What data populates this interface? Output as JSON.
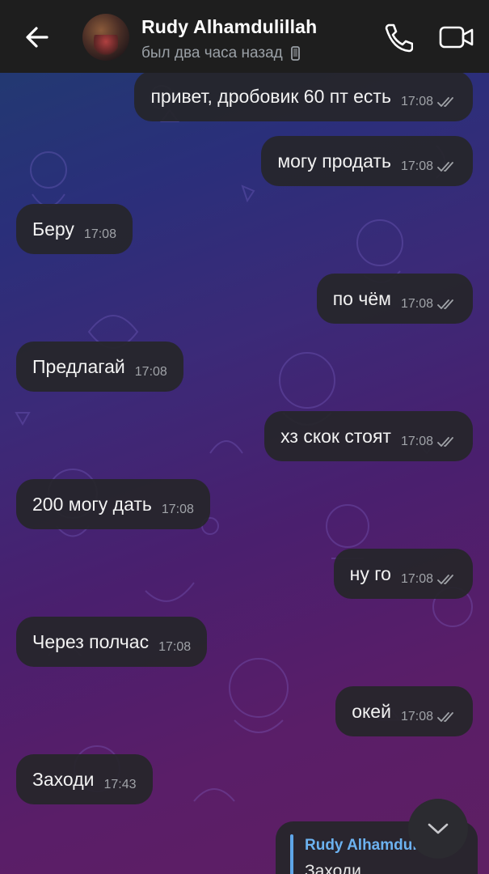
{
  "header": {
    "contact_name": "Rudy Alhamdulillah",
    "status": "был два часа назад",
    "back_icon": "arrow-back-icon",
    "call_icon": "phone-icon",
    "video_icon": "video-camera-icon"
  },
  "messages": [
    {
      "direction": "out",
      "text": "привет, дробовик 60 пт есть",
      "time": "17:08",
      "status": "read"
    },
    {
      "direction": "out",
      "text": "могу продать",
      "time": "17:08",
      "status": "read"
    },
    {
      "direction": "in",
      "text": "Беру",
      "time": "17:08"
    },
    {
      "direction": "out",
      "text": "по чём",
      "time": "17:08",
      "status": "read"
    },
    {
      "direction": "in",
      "text": "Предлагай",
      "time": "17:08"
    },
    {
      "direction": "out",
      "text": "хз скок стоят",
      "time": "17:08",
      "status": "read"
    },
    {
      "direction": "in",
      "text": "200 могу дать",
      "time": "17:08"
    },
    {
      "direction": "out",
      "text": "ну го",
      "time": "17:08",
      "status": "read"
    },
    {
      "direction": "in",
      "text": "Через полчас",
      "time": "17:08"
    },
    {
      "direction": "out",
      "text": "окей",
      "time": "17:08",
      "status": "read"
    },
    {
      "direction": "in",
      "text": "Заходи",
      "time": "17:43"
    }
  ],
  "reply_preview": {
    "name": "Rudy Alhamdulillah",
    "text": "Заходи"
  },
  "colors": {
    "header_bg": "#1e1e1e",
    "bubble_bg": "#26262a",
    "accent": "#6cb2f0"
  }
}
